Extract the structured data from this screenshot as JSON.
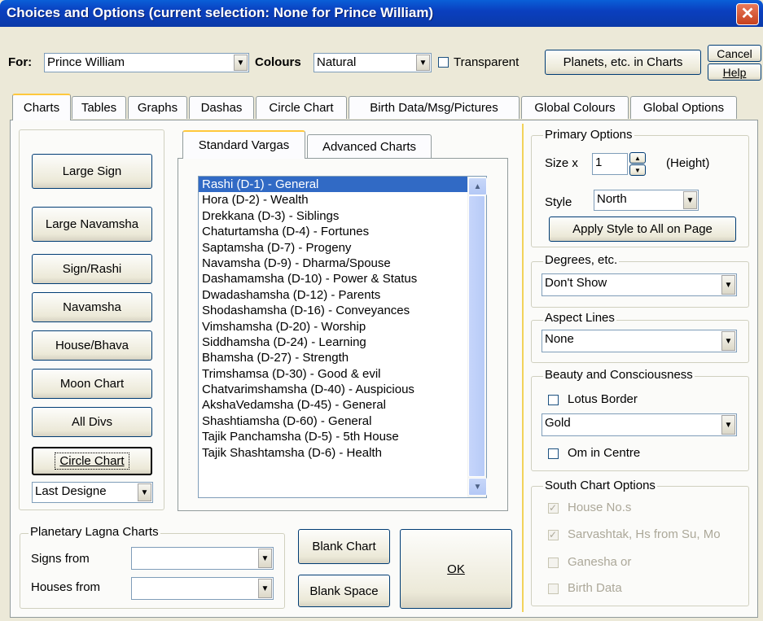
{
  "window": {
    "title": "Choices and Options (current selection: None for Prince William)",
    "close": "✕"
  },
  "toolbar": {
    "for_label": "For:",
    "for_value": "Prince William",
    "colours_label": "Colours",
    "colours_value": "Natural",
    "transparent_label": "Transparent",
    "planets_button": "Planets, etc. in Charts",
    "cancel_button": "Cancel",
    "help_button": "Help"
  },
  "tabs": [
    "Charts",
    "Tables",
    "Graphs",
    "Dashas",
    "Circle Chart",
    "Birth Data/Msg/Pictures",
    "Global Colours",
    "Global Options"
  ],
  "left_buttons": [
    "Large Sign",
    "Large Navamsha",
    "Sign/Rashi",
    "Navamsha",
    "House/Bhava",
    "Moon Chart",
    "All Divs",
    "Circle Chart"
  ],
  "last_designed": "Last Designe",
  "subtabs": [
    "Standard Vargas",
    "Advanced Charts"
  ],
  "vargas": [
    "Rashi (D-1) - General",
    "Hora (D-2) - Wealth",
    "Drekkana (D-3) - Siblings",
    "Chaturtamsha (D-4) - Fortunes",
    "Saptamsha (D-7) - Progeny",
    "Navamsha (D-9) - Dharma/Spouse",
    "Dashamamsha (D-10) - Power & Status",
    "Dwadashamsha (D-12) - Parents",
    "Shodashamsha (D-16) - Conveyances",
    "Vimshamsha (D-20) - Worship",
    "Siddhamsha (D-24) - Learning",
    "Bhamsha (D-27) - Strength",
    "Trimshamsa (D-30) - Good & evil",
    "Chatvarimshamsha (D-40) - Auspicious",
    "AkshaVedamsha (D-45) - General",
    "Shashtiamsha (D-60) - General",
    "Tajik Panchamsha (D-5) - 5th House",
    "Tajik Shashtamsha (D-6) - Health"
  ],
  "planetary_lagna": {
    "title": "Planetary Lagna Charts",
    "signs_from": "Signs from",
    "houses_from": "Houses from"
  },
  "bottom_buttons": {
    "blank_chart": "Blank Chart",
    "blank_space": "Blank Space",
    "ok": "OK"
  },
  "primary_options": {
    "title": "Primary Options",
    "size_label": "Size x",
    "size_value": "1",
    "height_label": "(Height)",
    "style_label": "Style",
    "style_value": "North",
    "apply_button": "Apply Style to All on Page"
  },
  "degrees": {
    "title": "Degrees, etc.",
    "value": "Don't Show"
  },
  "aspect_lines": {
    "title": "Aspect Lines",
    "value": "None"
  },
  "beauty": {
    "title": "Beauty and Consciousness",
    "lotus_border": "Lotus Border",
    "border_colour": "Gold",
    "om_centre": "Om in Centre"
  },
  "south_chart": {
    "title": "South Chart Options",
    "house_nos": "House No.s",
    "sarvashtak": "Sarvashtak, Hs from Su, Mo",
    "ganesha": "Ganesha or",
    "birth_data": "Birth Data",
    "checkmark": "✓"
  },
  "icons": {
    "dropdown": "▼",
    "up": "▲",
    "down": "▼"
  }
}
